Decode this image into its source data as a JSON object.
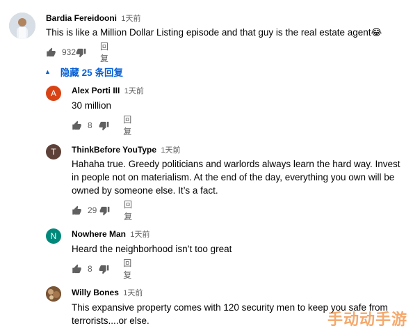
{
  "top_comment": {
    "author": "Bardia Fereidooni",
    "time": "1天前",
    "text": "This is like a Million Dollar Listing episode and that guy is the real estate agent😂",
    "likes": "932",
    "reply_label": "回复"
  },
  "replies_toggle": {
    "label": "隐藏 25 条回复",
    "icon": "chevron-up-icon"
  },
  "replies": [
    {
      "author": "Alex Porti III",
      "time": "1天前",
      "avatar_letter": "A",
      "avatar_color": "#d84315",
      "text": "30 million",
      "likes": "8",
      "reply_label": "回复"
    },
    {
      "author": "ThinkBefore YouType",
      "time": "1天前",
      "avatar_letter": "T",
      "avatar_color": "#5d4037",
      "text": "Hahaha true. Greedy politicians and warlords always learn the hard way. Invest in people not on materialism. At the end of the day, everything you own will be owned by someone else. It’s a fact.",
      "likes": "29",
      "reply_label": "回复"
    },
    {
      "author": "Nowhere Man",
      "time": "1天前",
      "avatar_letter": "N",
      "avatar_color": "#00897b",
      "text": "Heard the neighborhood isn’t too great",
      "likes": "8",
      "reply_label": "回复"
    },
    {
      "author": "Willy Bones",
      "time": "1天前",
      "avatar_letter": "",
      "avatar_color": "#6d4c2f",
      "text": "This expansive property comes with 120 security men to keep you safe from terrorists....or else.",
      "likes": "",
      "reply_label": ""
    }
  ],
  "watermark": "手动动手游"
}
